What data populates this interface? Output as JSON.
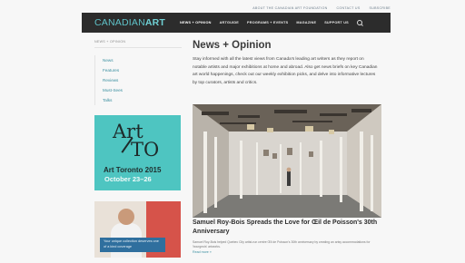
{
  "utility_links": [
    "ABOUT THE CANADIAN ART FOUNDATION",
    "CONTACT US",
    "SUBSCRIBE"
  ],
  "brand": {
    "logo_light": "CANADIAN",
    "logo_bold": "ART"
  },
  "nav": {
    "items": [
      "NEWS + OPINION",
      "ARTGUIDE",
      "PROGRAMS + EVENTS",
      "MAGAZINE",
      "SUPPORT US"
    ],
    "search_icon": "search-icon"
  },
  "sidebar": {
    "breadcrumb": "NEWS + OPINION",
    "links": [
      "News",
      "Features",
      "Reviews",
      "Must-Sees",
      "Talks"
    ]
  },
  "ads": {
    "art_to": {
      "line1": "Art",
      "line2": "TO",
      "event": "Art Toronto 2015",
      "dates": "October 23–26",
      "colors": {
        "background": "#4ec5c1"
      }
    },
    "collection": {
      "caption": "Your unique collection deserves one of a kind coverage"
    }
  },
  "main": {
    "title": "News + Opinion",
    "intro": "Stay informed with all the latest views from Canada's leading art writers as they report on notable artists and major exhibitions at home and abroad. Also get news briefs on key Canadian art world happenings, check out our weekly exhibition picks, and delve into informative lectures by top curators, artists and critics.",
    "featured": {
      "title": "Samuel Roy-Bois Spreads the Love for Œil de Poisson's 30th Anniversary",
      "excerpt": "Samuel Roy-Bois helped Quebec City artist-run centre Œil de Poisson's 30th anniversary by creating an artsy accommodations for 'bourgeois' artworks.",
      "read_more": "Read more »"
    }
  },
  "colors": {
    "header": "#2c2c2c",
    "accent": "#5fc3c9",
    "link": "#3a8fa0"
  }
}
